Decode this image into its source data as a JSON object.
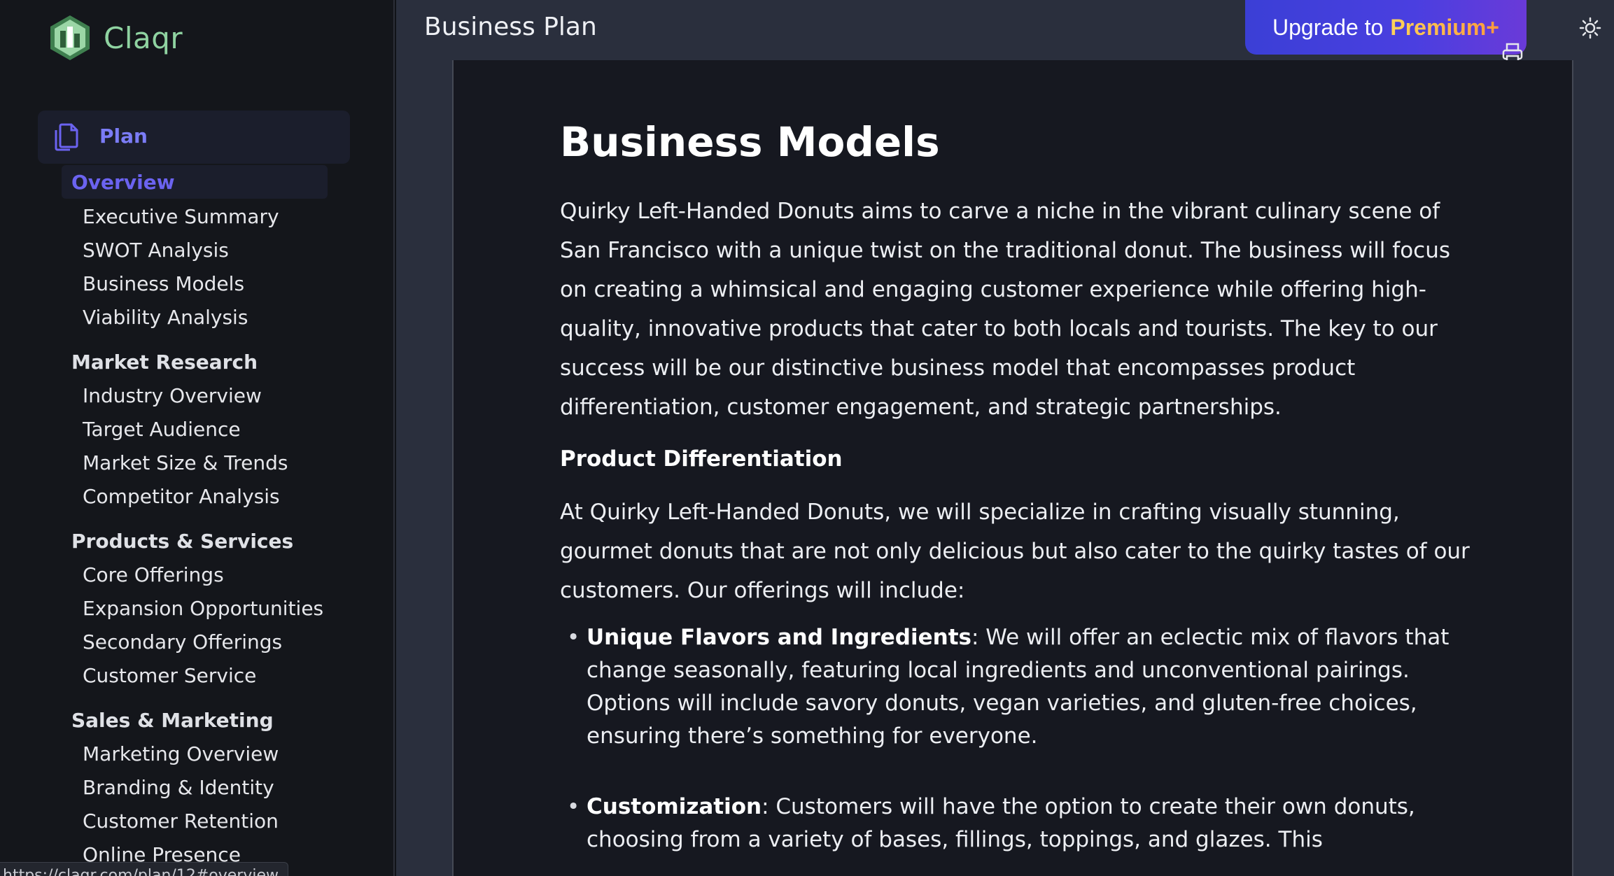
{
  "brand": {
    "name": "Claqr"
  },
  "sidebar": {
    "plan_label": "Plan",
    "overview_label": "Overview",
    "overview_items": [
      "Executive Summary",
      "SWOT Analysis",
      "Business Models",
      "Viability Analysis"
    ],
    "sections": [
      {
        "title": "Market Research",
        "items": [
          "Industry Overview",
          "Target Audience",
          "Market Size & Trends",
          "Competitor Analysis"
        ]
      },
      {
        "title": "Products & Services",
        "items": [
          "Core Offerings",
          "Expansion Opportunities",
          "Secondary Offerings",
          "Customer Service"
        ]
      },
      {
        "title": "Sales & Marketing",
        "items": [
          "Marketing Overview",
          "Branding & Identity",
          "Customer Retention",
          "Online Presence"
        ]
      }
    ]
  },
  "status_bar": {
    "url": "https://claqr.com/plan/12#overview"
  },
  "header": {
    "title": "Business Plan",
    "upgrade_prefix": "Upgrade to",
    "upgrade_highlight": "Premium+",
    "print_icon": "printer-icon",
    "theme_icon": "sun-icon"
  },
  "document": {
    "heading": "Business Models",
    "intro": "Quirky Left-Handed Donuts aims to carve a niche in the vibrant culinary scene of San Francisco with a unique twist on the traditional donut. The business will focus on creating a whimsical and engaging customer experience while offering high-quality, innovative products that cater to both locals and tourists. The key to our success will be our distinctive business model that encompasses product differentiation, customer engagement, and strategic partnerships.",
    "subheading": "Product Differentiation",
    "para2": "At Quirky Left-Handed Donuts, we will specialize in crafting visually stunning, gourmet donuts that are not only delicious but also cater to the quirky tastes of our customers. Our offerings will include:",
    "bullets": [
      {
        "title": "Unique Flavors and Ingredients",
        "text": ": We will offer an eclectic mix of flavors that change seasonally, featuring local ingredients and unconventional pairings. Options will include savory donuts, vegan varieties, and gluten-free choices, ensuring there’s something for everyone."
      },
      {
        "title": "Customization",
        "text": ": Customers will have the option to create their own donuts, choosing from a variety of bases, fillings, toppings, and glazes. This"
      }
    ]
  },
  "colors": {
    "accent": "#6b63f0",
    "brand_green": "#8fd3a1",
    "upgrade_gradient_start": "#3b3fd6",
    "premium_gold": "#ffd45a"
  }
}
